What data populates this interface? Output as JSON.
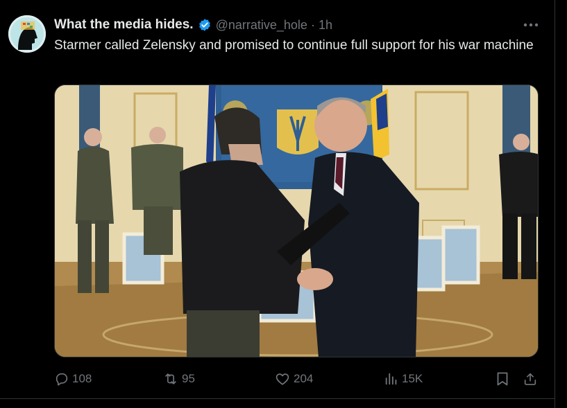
{
  "post": {
    "author_name": "What the media hides.",
    "handle": "@narrative_hole",
    "separator": "·",
    "time": "1h",
    "text": "Starmer called Zelensky and promised to continue full support for his war machine"
  },
  "stats": {
    "replies": "108",
    "reposts": "95",
    "likes": "204",
    "views": "15K"
  },
  "colors": {
    "background": "#000000",
    "text": "#e7e9ea",
    "secondary": "#71767b",
    "verified": "#1d9bf0",
    "border": "#2f3336"
  },
  "icons": [
    "avatar",
    "verified-badge-icon",
    "more-options-icon",
    "reply-icon",
    "repost-icon",
    "like-icon",
    "views-icon",
    "bookmark-icon",
    "share-icon"
  ]
}
